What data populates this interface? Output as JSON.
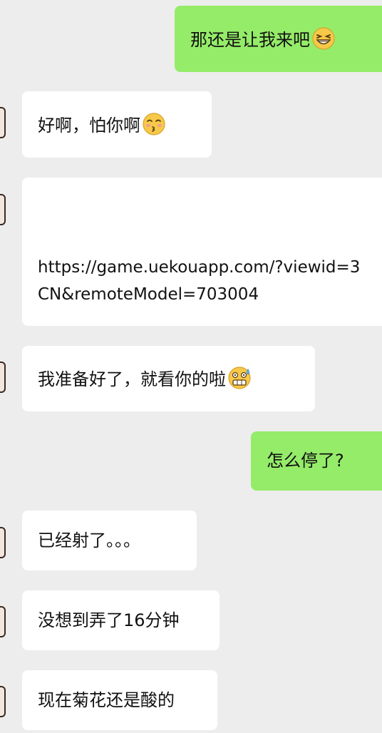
{
  "messages": [
    {
      "side": "out",
      "text": "那还是让我来吧",
      "emoji": "grinning-squint-emoji"
    },
    {
      "side": "in",
      "text": "好啊，怕你啊",
      "emoji": "kissing-blush-emoji"
    },
    {
      "side": "in",
      "line1": "https://game.uekouapp.com/?viewid=3",
      "line2": "CN&remoteModel=703004"
    },
    {
      "side": "in",
      "text": "我准备好了，就看你的啦",
      "emoji": "sweat-grin-emoji"
    },
    {
      "side": "out",
      "text": "怎么停了?"
    },
    {
      "side": "in",
      "text": "已经射了。。。"
    },
    {
      "side": "in",
      "text": "没想到弄了16分钟"
    },
    {
      "side": "in",
      "text": "现在菊花还是酸的"
    }
  ],
  "colors": {
    "background": "#ededed",
    "incoming_bubble": "#ffffff",
    "outgoing_bubble": "#95ec69",
    "text": "#111111"
  }
}
